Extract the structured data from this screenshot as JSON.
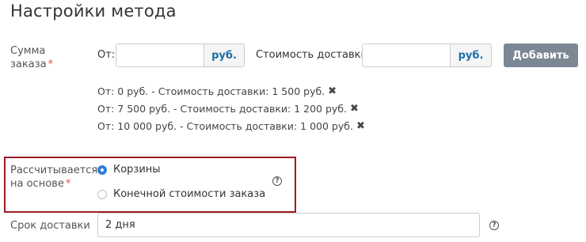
{
  "page": {
    "title": "Настройки метода"
  },
  "order_sum": {
    "label_line1": "Сумма",
    "label_line2": "заказа",
    "required_mark": "*",
    "from_label": "От:",
    "from_value": "",
    "from_unit": "руб.",
    "cost_label": "Стоимость доставки:",
    "cost_value": "",
    "cost_unit": "руб.",
    "add_button": "Добавить",
    "rules": [
      {
        "text": "От: 0 руб. - Стоимость доставки: 1 500 руб.",
        "remove_icon": "close-icon",
        "remove_glyph": "✖"
      },
      {
        "text": "От: 7 500 руб. - Стоимость доставки: 1 200 руб.",
        "remove_icon": "close-icon",
        "remove_glyph": "✖"
      },
      {
        "text": "От: 10 000 руб. - Стоимость доставки: 1 000 руб.",
        "remove_icon": "close-icon",
        "remove_glyph": "✖"
      }
    ]
  },
  "calc_basis": {
    "label_line1": "Рассчитывается",
    "label_line2": "на основе",
    "required_mark": "*",
    "options": [
      {
        "label": "Корзины",
        "checked": true
      },
      {
        "label": "Конечной стоимости заказа",
        "checked": false
      }
    ],
    "help_glyph": "?",
    "highlight_color": "#9b1c24"
  },
  "delivery_time": {
    "label": "Срок доставки",
    "value": "2 дня",
    "help_glyph": "?"
  },
  "colors": {
    "accent": "#2f7fd6",
    "unit_text": "#1f6fa8",
    "button_bg": "#7b8893"
  }
}
